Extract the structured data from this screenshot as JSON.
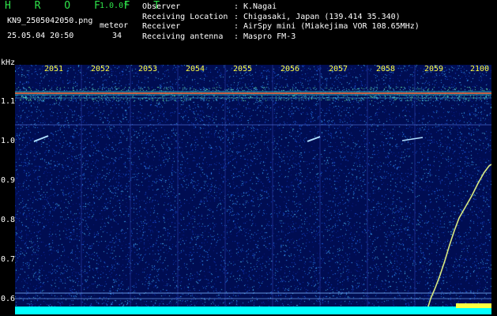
{
  "header": {
    "title": "H R O F F T",
    "version": "1.0.0f",
    "filename": "KN9_2505042050.png",
    "meteor_label": "meteor",
    "datetime": "25.05.04 20:50",
    "meteor_count": "34"
  },
  "info": [
    {
      "key": "Observer",
      "sep": ":",
      "value": "K.Nagai"
    },
    {
      "key": "Receiving Location",
      "sep": ":",
      "value": "Chigasaki, Japan (139.414 35.340)"
    },
    {
      "key": "Receiver",
      "sep": ":",
      "value": "AirSpy mini (Miakejima VOR 108.65MHz)"
    },
    {
      "key": "Receiving antenna",
      "sep": ":",
      "value": "Maspro FM-3"
    }
  ],
  "y_axis": {
    "unit": "kHz",
    "ticks": [
      "1.1",
      "1.0",
      "0.9",
      "0.8",
      "0.7",
      "0.6"
    ]
  },
  "time_labels": [
    "2051",
    "2052",
    "2053",
    "2054",
    "2055",
    "2056",
    "2057",
    "2058",
    "2059",
    "2100"
  ],
  "colors": {
    "background": "#000d52",
    "carrier": "#ff6030",
    "trace": "#ffff40",
    "baseline": "#00ffff",
    "title": "#2fe34a"
  }
}
